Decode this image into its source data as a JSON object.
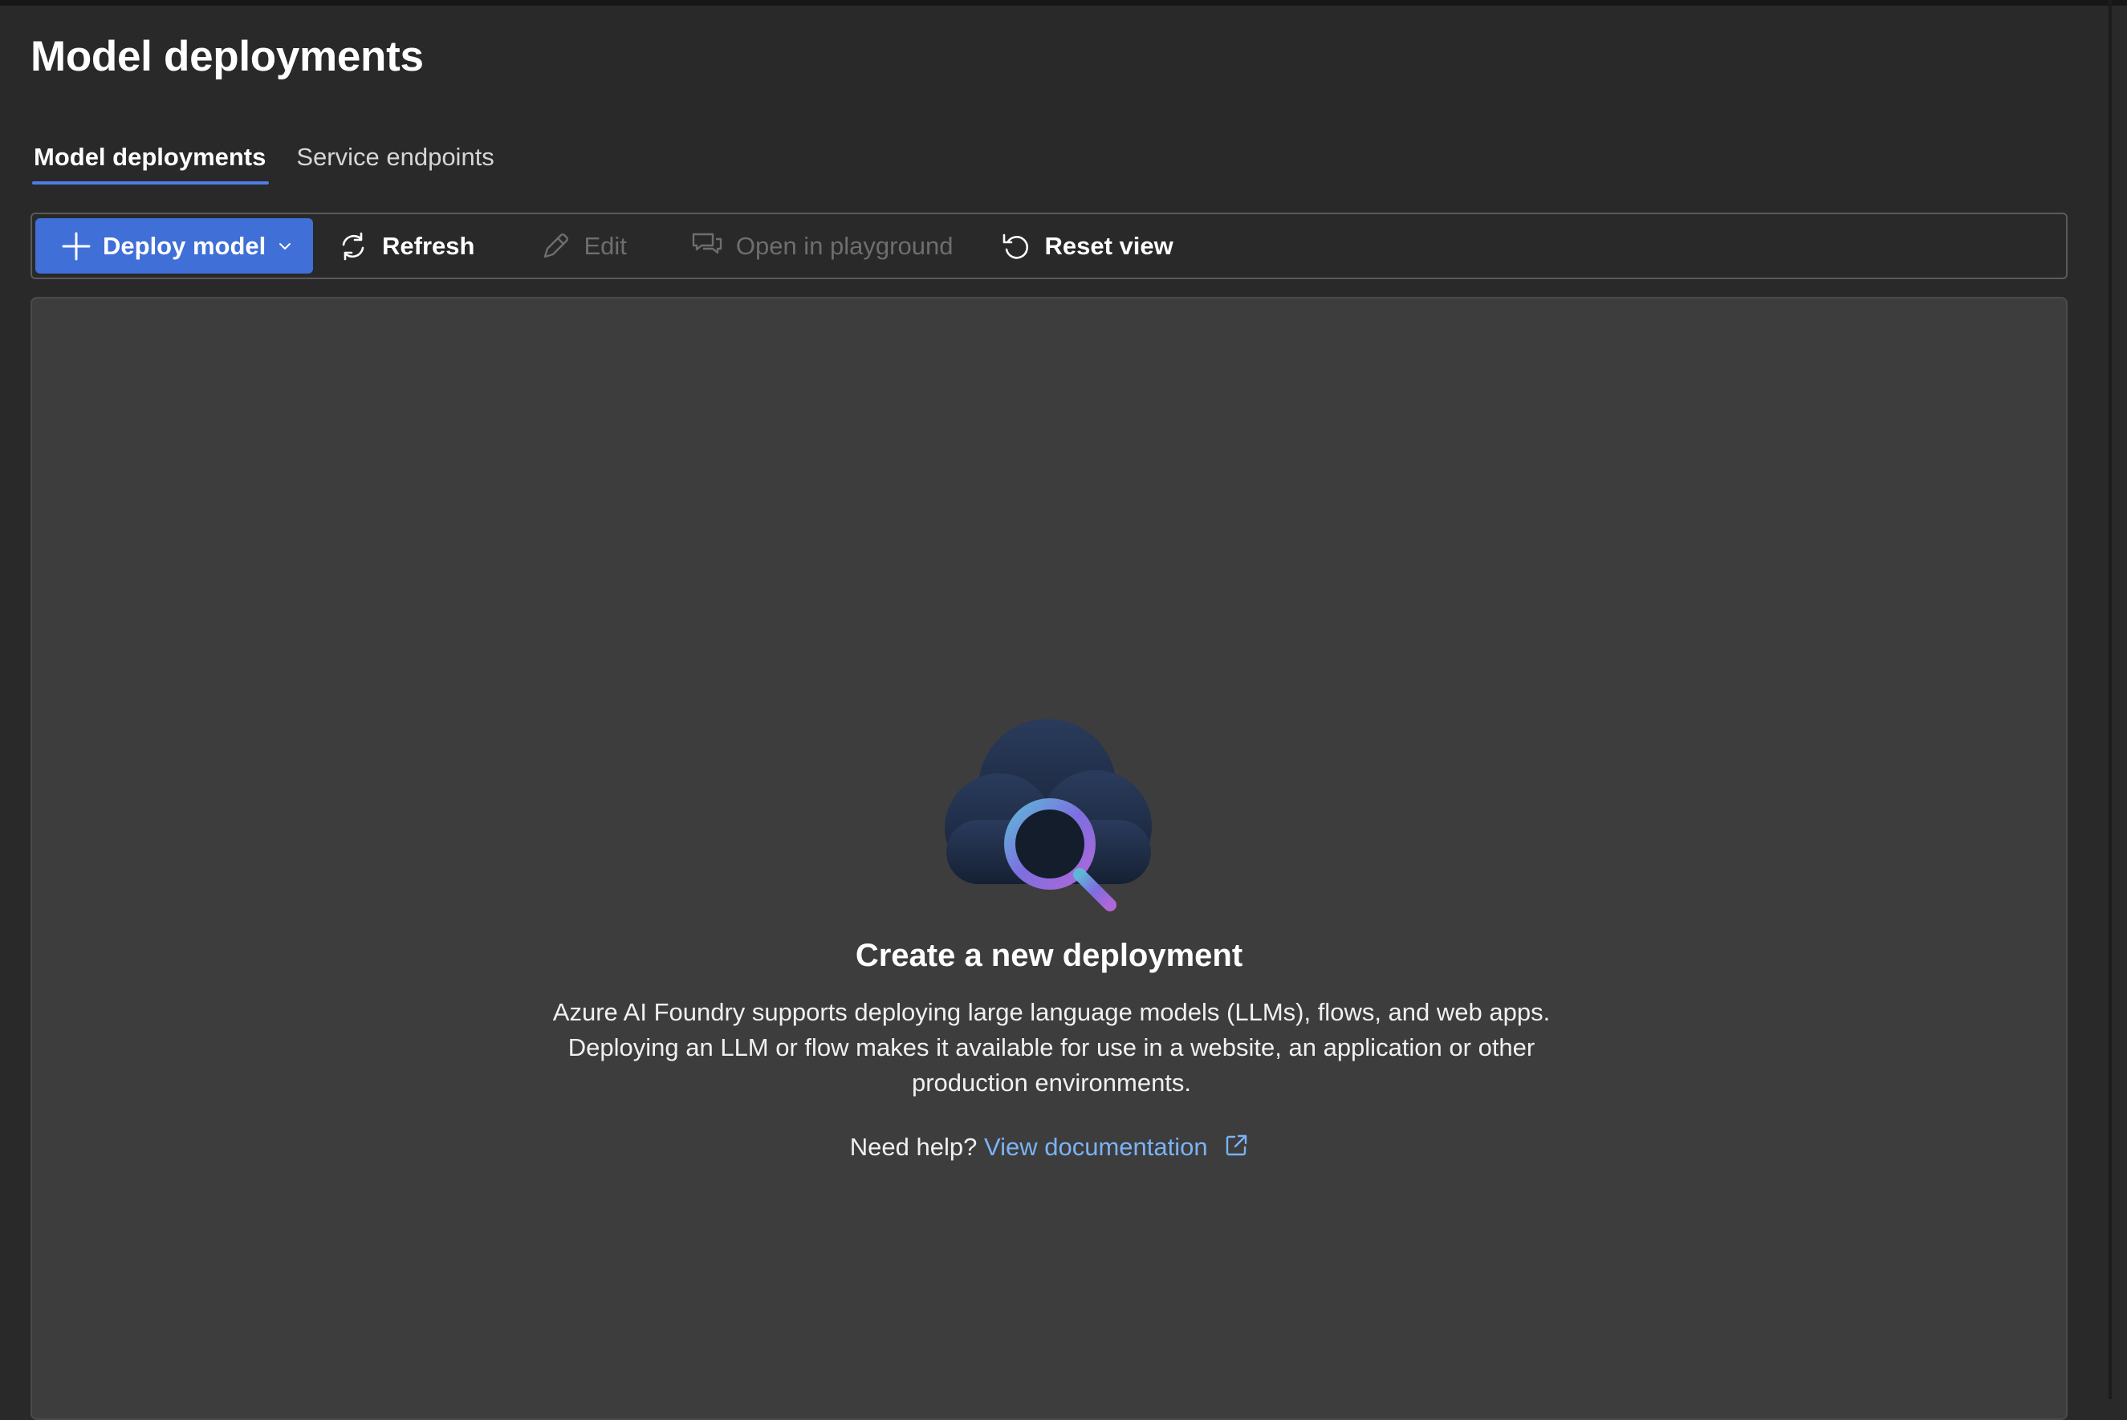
{
  "page": {
    "title": "Model deployments"
  },
  "tabs": [
    {
      "label": "Model deployments",
      "active": true
    },
    {
      "label": "Service endpoints",
      "active": false
    }
  ],
  "toolbar": {
    "deploy_label": "Deploy model",
    "refresh_label": "Refresh",
    "edit_label": "Edit",
    "playground_label": "Open in playground",
    "reset_label": "Reset view"
  },
  "empty_state": {
    "title": "Create a new deployment",
    "description": "Azure AI Foundry supports deploying large language models (LLMs), flows, and web apps. Deploying an LLM or flow makes it available for use in a website, an application or other production environments.",
    "help_prefix": "Need help?",
    "link_label": "View documentation",
    "illustration_icon": "cloud-search-icon"
  },
  "colors": {
    "background": "#292929",
    "panel": "#3d3d3d",
    "accent": "#3f6fd7",
    "link": "#7cb2f5"
  }
}
